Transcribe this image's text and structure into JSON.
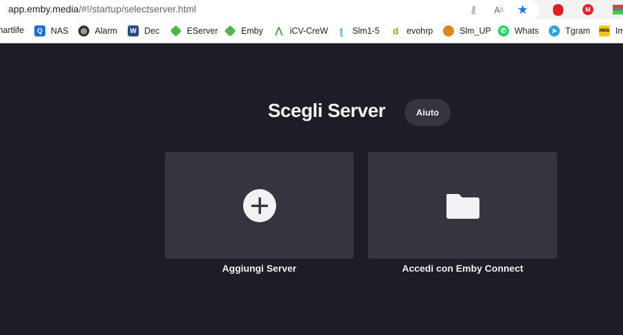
{
  "browser": {
    "url_host": "app.emby.media",
    "url_path": "/#!/startup/selectserver.html",
    "toolbar_icons": [
      "key-icon",
      "read-aloud-icon",
      "star-icon",
      "ublock-icon",
      "mega-icon",
      "extension-icon"
    ],
    "bookmarks": [
      {
        "label": "martlife",
        "color": "#ffffff"
      },
      {
        "label": "NAS",
        "color": "#1e6fd9"
      },
      {
        "label": "Alarm",
        "color": "#333333"
      },
      {
        "label": "Dec",
        "color": "#2a4a8a"
      },
      {
        "label": "EServer",
        "color": "#52b54b"
      },
      {
        "label": "Emby",
        "color": "#52b54b"
      },
      {
        "label": "iCV-CreW",
        "color": "#3a9a3a"
      },
      {
        "label": "Slm1-5",
        "color": "#2ab0d8"
      },
      {
        "label": "evohrp",
        "color": "#7ab51d"
      },
      {
        "label": "Slm_UP",
        "color": "#d98a1a"
      },
      {
        "label": "Whats",
        "color": "#25d366"
      },
      {
        "label": "Tgram",
        "color": "#2aa1e0"
      },
      {
        "label": "Im",
        "color": "#f5c518"
      }
    ]
  },
  "page": {
    "title": "Scegli Server",
    "help_label": "Aiuto",
    "cards": [
      {
        "label": "Aggiungi Server",
        "icon": "add-circle-icon"
      },
      {
        "label": "Accedi con Emby Connect",
        "icon": "folder-icon"
      }
    ]
  }
}
